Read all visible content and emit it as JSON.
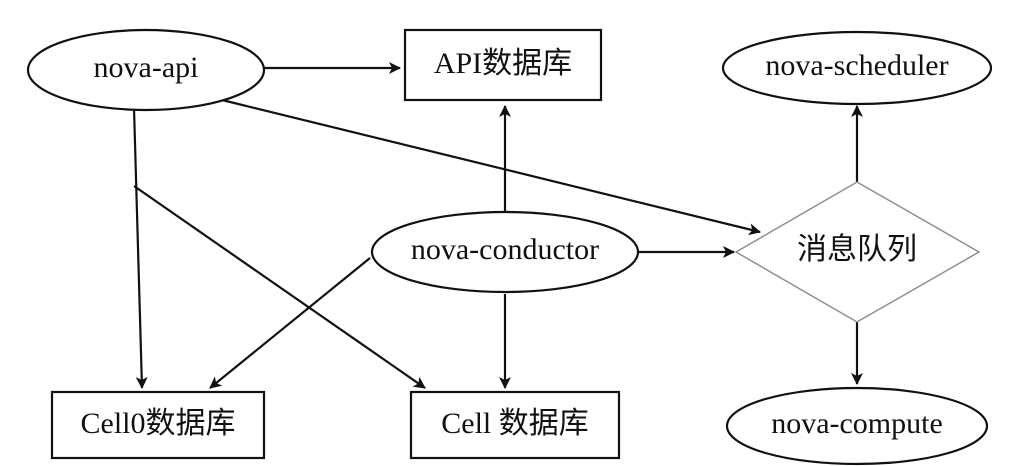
{
  "nodes": {
    "nova_api": "nova-api",
    "api_db": "API数据库",
    "nova_scheduler": "nova-scheduler",
    "nova_conductor": "nova-conductor",
    "message_queue": "消息队列",
    "cell0_db": "Cell0数据库",
    "cell_db": "Cell 数据库",
    "nova_compute": "nova-compute"
  },
  "edges": [
    {
      "from": "nova-api",
      "to": "API数据库"
    },
    {
      "from": "nova-api",
      "to": "消息队列"
    },
    {
      "from": "nova-api",
      "to": "Cell0数据库"
    },
    {
      "from": "nova-api",
      "to": "Cell 数据库"
    },
    {
      "from": "nova-conductor",
      "to": "API数据库"
    },
    {
      "from": "nova-conductor",
      "to": "消息队列"
    },
    {
      "from": "nova-conductor",
      "to": "Cell0数据库"
    },
    {
      "from": "nova-conductor",
      "to": "Cell 数据库"
    },
    {
      "from": "消息队列",
      "to": "nova-scheduler"
    },
    {
      "from": "消息队列",
      "to": "nova-compute"
    }
  ],
  "colors": {
    "stroke": "#111111",
    "diamond_stroke": "#8a8a8a",
    "background": "#ffffff"
  }
}
